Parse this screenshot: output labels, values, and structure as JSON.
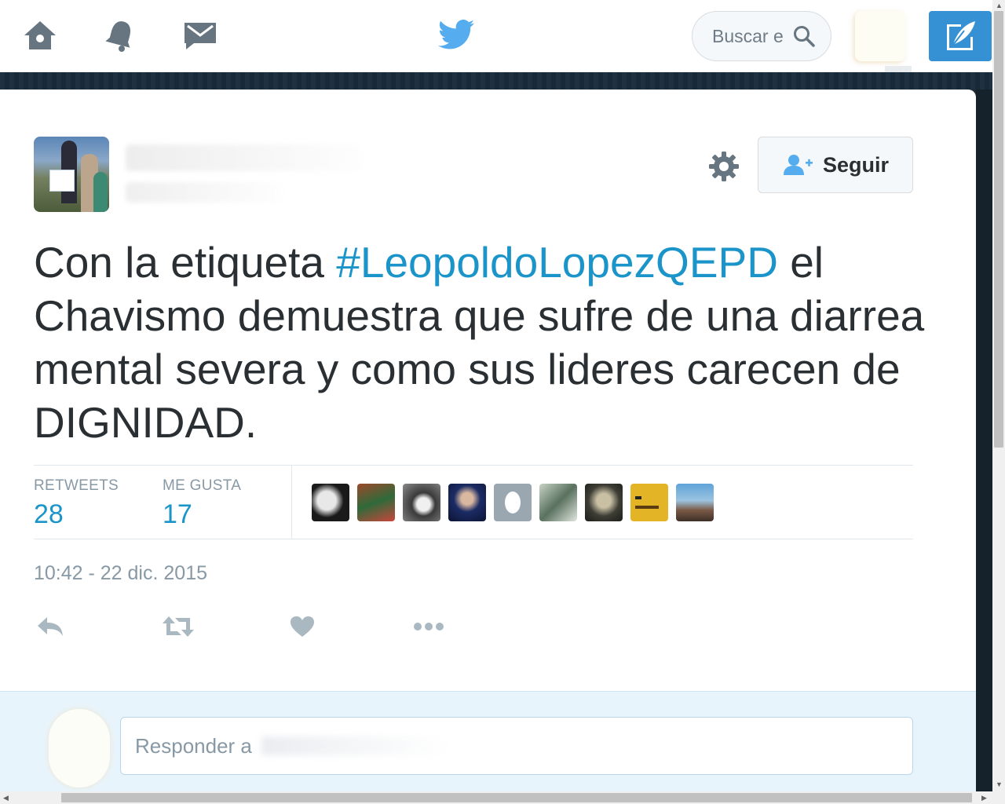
{
  "nav": {
    "search_placeholder": "Buscar e"
  },
  "tweet": {
    "follow_label": "Seguir",
    "text_before": "Con la etiqueta ",
    "hashtag": "#LeopoldoLopezQEPD",
    "text_after": " el Chavismo demuestra que sufre de una diarrea mental severa y como sus lideres carecen de DIGNIDAD.",
    "stats": {
      "retweets_label": "RETWEETS",
      "retweets_count": "28",
      "likes_label": "ME GUSTA",
      "likes_count": "17"
    },
    "timestamp": "10:42 - 22 dic. 2015"
  },
  "reply": {
    "placeholder": "Responder a"
  },
  "colors": {
    "accent": "#1b95c9",
    "compose": "#3591d4",
    "text": "#292f33",
    "muted": "#8899a6"
  },
  "icons": [
    "home-icon",
    "notifications-icon",
    "messages-icon",
    "twitter-bird-icon",
    "search-icon",
    "compose-icon",
    "gear-icon",
    "follow-user-icon",
    "reply-icon",
    "retweet-icon",
    "like-icon",
    "more-icon"
  ]
}
